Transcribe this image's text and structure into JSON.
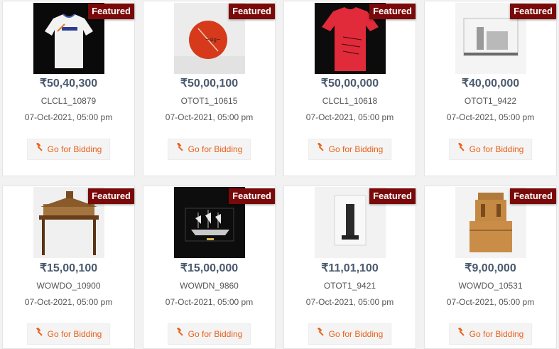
{
  "badge_label": "Featured",
  "button_label": "Go for Bidding",
  "accent_color": "#e8621c",
  "badge_color": "#7a0a0a",
  "icons": {
    "bid": "gavel-icon"
  },
  "lots": [
    {
      "price": "₹50,40,300",
      "code": "CLCL1_10879",
      "date": "07-Oct-2021, 05:00 pm"
    },
    {
      "price": "₹50,00,100",
      "code": "OTOT1_10615",
      "date": "07-Oct-2021, 05:00 pm"
    },
    {
      "price": "₹50,00,000",
      "code": "CLCL1_10618",
      "date": "07-Oct-2021, 05:00 pm"
    },
    {
      "price": "₹40,00,000",
      "code": "OTOT1_9422",
      "date": "07-Oct-2021, 05:00 pm"
    },
    {
      "price": "₹15,00,100",
      "code": "WOWDO_10900",
      "date": "07-Oct-2021, 05:00 pm"
    },
    {
      "price": "₹15,00,000",
      "code": "WOWDN_9860",
      "date": "07-Oct-2021, 05:00 pm"
    },
    {
      "price": "₹11,01,100",
      "code": "OTOT1_9421",
      "date": "07-Oct-2021, 05:00 pm"
    },
    {
      "price": "₹9,00,000",
      "code": "WOWDO_10531",
      "date": "07-Oct-2021, 05:00 pm"
    }
  ]
}
